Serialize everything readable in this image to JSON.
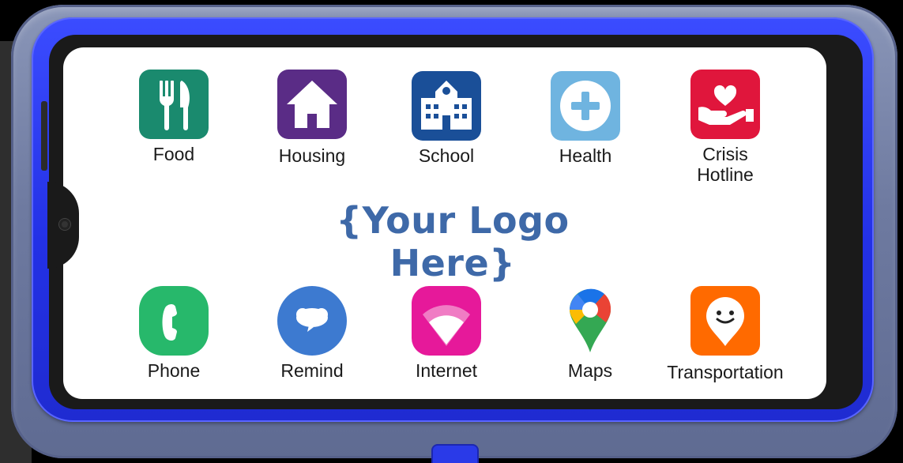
{
  "logo_text": "{Your Logo Here}",
  "apps_top": [
    {
      "label": "Food",
      "icon": "fork-knife-icon",
      "color": "#1a8a6e"
    },
    {
      "label": "Housing",
      "icon": "house-icon",
      "color": "#5a2c86"
    },
    {
      "label": "School",
      "icon": "school-building-icon",
      "color": "#1a4f98"
    },
    {
      "label": "Health",
      "icon": "medical-plus-icon",
      "color": "#6fb4e0"
    },
    {
      "label": "Crisis\nHotline",
      "icon": "heart-hand-icon",
      "color": "#e0163c"
    }
  ],
  "apps_bottom": [
    {
      "label": "Phone",
      "icon": "phone-icon",
      "color": "#27b86b"
    },
    {
      "label": "Remind",
      "icon": "speech-bubble-icon",
      "color": "#3d7ad0"
    },
    {
      "label": "Internet",
      "icon": "wifi-icon",
      "color": "#e6199a"
    },
    {
      "label": "Maps",
      "icon": "map-pin-icon",
      "color": "#ffffff"
    },
    {
      "label": "Transportation",
      "icon": "smiley-pin-icon",
      "color": "#ff6a00"
    }
  ]
}
